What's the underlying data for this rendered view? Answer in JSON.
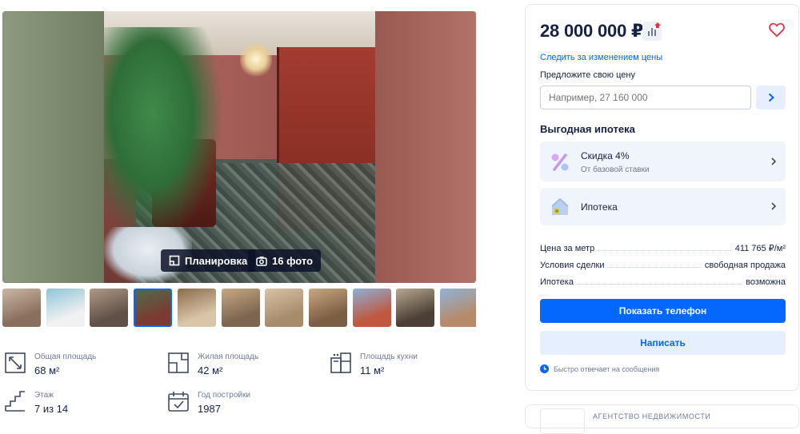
{
  "gallery": {
    "plan_label": "Планировка",
    "photos_label": "16 фото",
    "thumbnails": [
      {
        "color_a": "#8a6f5c",
        "color_b": "#c9b8a4"
      },
      {
        "color_a": "#f1f1f1",
        "color_b": "#8fc4d9"
      },
      {
        "color_a": "#5f5148",
        "color_b": "#b09a86"
      },
      {
        "color_a": "#7b3b32",
        "color_b": "#4f6b4c",
        "active": true
      },
      {
        "color_a": "#d9c5a8",
        "color_b": "#8a6b4a"
      },
      {
        "color_a": "#7d6550",
        "color_b": "#c9a982"
      },
      {
        "color_a": "#a78c6c",
        "color_b": "#d8c3a5"
      },
      {
        "color_a": "#7c5e44",
        "color_b": "#c8a880"
      },
      {
        "color_a": "#c0573e",
        "color_b": "#8cb0d8"
      },
      {
        "color_a": "#4c4036",
        "color_b": "#b8a88f"
      },
      {
        "color_a": "#b78a6a",
        "color_b": "#8fb3d9"
      }
    ]
  },
  "specs": [
    {
      "label": "Общая площадь",
      "value": "68 м²",
      "icon": "area-icon"
    },
    {
      "label": "Жилая площадь",
      "value": "42 м²",
      "icon": "living-area-icon"
    },
    {
      "label": "Площадь кухни",
      "value": "11 м²",
      "icon": "kitchen-icon"
    },
    {
      "label": "Этаж",
      "value": "7 из 14",
      "icon": "stairs-icon"
    },
    {
      "label": "Год постройки",
      "value": "1987",
      "icon": "calendar-icon"
    }
  ],
  "panel": {
    "price": "28 000 000 ₽",
    "follow_price": "Следить за изменением цены",
    "offer_label": "Предложите свою цену",
    "offer_placeholder": "Например, 27 160 000",
    "mortgage_title": "Выгодная ипотека",
    "card_discount_title": "Скидка 4%",
    "card_discount_sub": "От базовой ставки",
    "card_mortgage_title": "Ипотека",
    "details": [
      {
        "label": "Цена за метр",
        "value": "411 765 ₽/м²"
      },
      {
        "label": "Условия сделки",
        "value": "свободная продажа"
      },
      {
        "label": "Ипотека",
        "value": "возможна"
      }
    ],
    "phone_button": "Показать телефон",
    "write_button": "Написать",
    "fast_reply": "Быстро отвечает на сообщения"
  },
  "agency": {
    "label": "АГЕНТСТВО НЕДВИЖИМОСТИ"
  },
  "colors": {
    "accent": "#0468ff",
    "text": "#152242",
    "muted": "#707a95",
    "heart": "#e0354a"
  }
}
